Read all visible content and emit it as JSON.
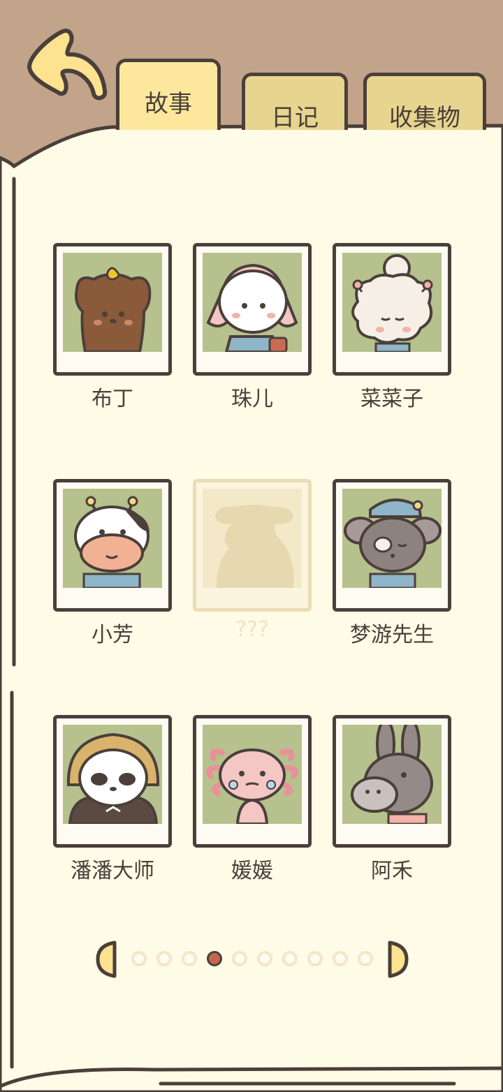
{
  "tabs": {
    "story": "故事",
    "diary": "日记",
    "collection": "收集物"
  },
  "characters": [
    {
      "name": "布丁",
      "icon": "pudding-dog-portrait-icon"
    },
    {
      "name": "珠儿",
      "icon": "zhuer-cat-portrait-icon"
    },
    {
      "name": "菜菜子",
      "icon": "caicaizi-sheep-portrait-icon"
    },
    {
      "name": "小芳",
      "icon": "xiaofang-cow-portrait-icon"
    },
    {
      "name": "???",
      "icon": "locked-silhouette-icon"
    },
    {
      "name": "梦游先生",
      "icon": "mengyou-mouse-portrait-icon"
    },
    {
      "name": "潘潘大师",
      "icon": "panpan-panda-portrait-icon"
    },
    {
      "name": "媛媛",
      "icon": "yuanyuan-axolotl-portrait-icon"
    },
    {
      "name": "阿禾",
      "icon": "ahe-donkey-portrait-icon"
    }
  ],
  "pagination": {
    "total_pages": 10,
    "current_page": 4
  },
  "colors": {
    "page_bg": "#fefbe6",
    "header_bg": "#c2a48a",
    "outline": "#4a3f3a",
    "active_tab": "#fde79d",
    "inactive_tab": "#e7d48f",
    "photo_bg": "#b6c18d",
    "active_dot": "#c4674b"
  }
}
